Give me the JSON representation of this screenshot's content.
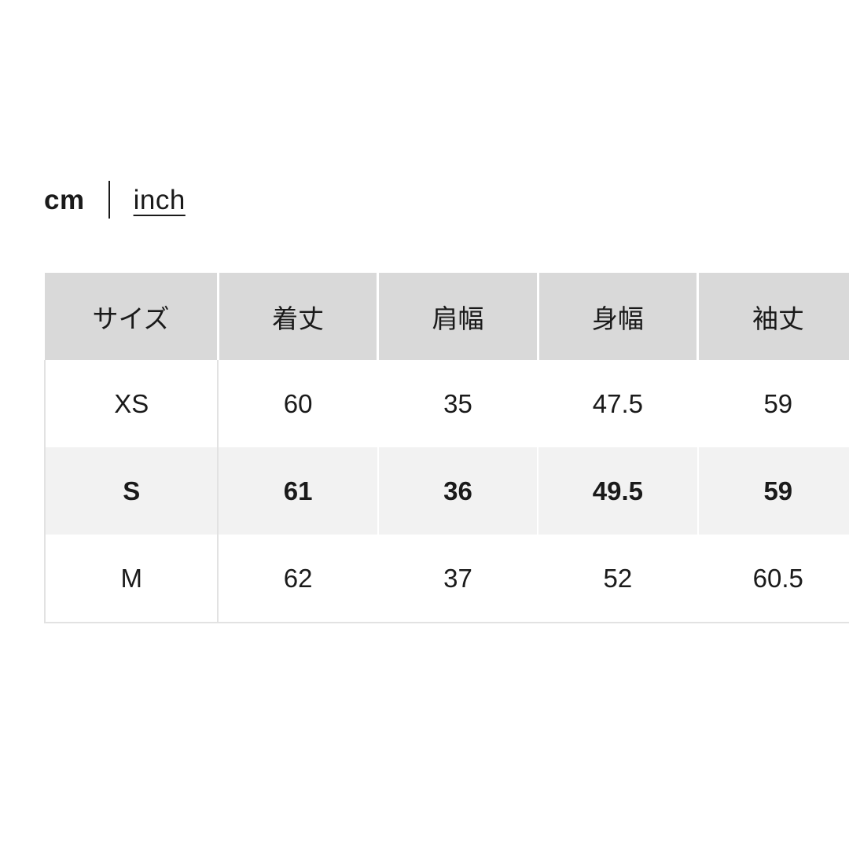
{
  "unit_toggle": {
    "name": "unit-toggle",
    "active_unit": "cm",
    "options": [
      {
        "label": "cm",
        "state": "active"
      },
      {
        "label": "inch",
        "state": "link"
      }
    ],
    "divider": "|"
  },
  "size_table": {
    "columns": [
      "サイズ",
      "着丈",
      "肩幅",
      "身幅",
      "袖丈"
    ],
    "rows": [
      {
        "size": "XS",
        "values": [
          "60",
          "35",
          "47.5",
          "59"
        ],
        "highlighted": false
      },
      {
        "size": "S",
        "values": [
          "61",
          "36",
          "49.5",
          "59"
        ],
        "highlighted": true
      },
      {
        "size": "M",
        "values": [
          "62",
          "37",
          "52",
          "60.5"
        ],
        "highlighted": false
      }
    ],
    "selected_size": "S",
    "unit": "cm"
  },
  "colors": {
    "page_background": "#ffffff",
    "header_background": "#d9d9d9",
    "highlight_row_background": "#f2f2f2",
    "row_background": "#ffffff",
    "border": "#e2e2e2",
    "text": "#1a1a1a"
  }
}
